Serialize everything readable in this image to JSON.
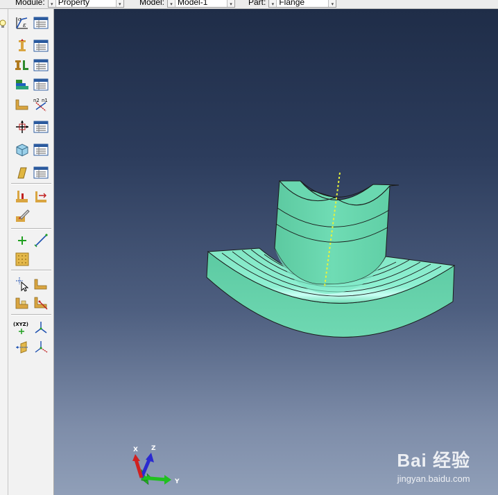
{
  "context_bar": {
    "module": {
      "label": "Module:",
      "value": "Property"
    },
    "model": {
      "label": "Model:",
      "value": "Model-1"
    },
    "part": {
      "label": "Part:",
      "value": "Flange"
    }
  },
  "toolbox": {
    "icons": [
      "create-material-icon",
      "material-manager-icon",
      "create-section-icon",
      "section-manager-icon",
      "create-profile-icon",
      "profile-manager-icon",
      "create-composite-layup-icon",
      "composite-layup-manager-icon",
      "assign-section-icon",
      "assign-beam-orientation-icon",
      "assign-material-orientation-icon",
      "orientation-manager-icon",
      "create-skin-icon",
      "skin-manager-icon",
      "create-stringer-icon",
      "stringer-manager-icon",
      "special-inertia-icon",
      "special-springs-icon",
      "query-tool-icon",
      "create-point-icon",
      "create-axis-icon",
      "create-datum-plane-icon",
      "partition-select-icon",
      "partition-face-icon",
      "partition-cell-icon",
      "partition-edge-icon",
      "datum-csys-icon",
      "datum-axis-icon",
      "datum-transform-icon",
      "datum-triad-icon"
    ],
    "xyz_glyph": "(XYZ)"
  },
  "viewport": {
    "triad": {
      "x": "X",
      "y": "Y",
      "z": "Z"
    },
    "colors": {
      "part_fill": "#6fdcb4",
      "axis_line": "#e8f23a"
    }
  },
  "watermark": {
    "brand": "Bai 经验",
    "url": "jingyan.baidu.com"
  }
}
